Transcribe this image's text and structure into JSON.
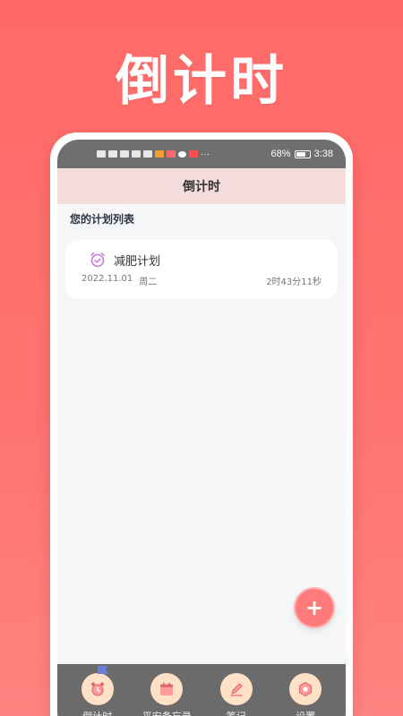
{
  "hero": {
    "title": "倒计时"
  },
  "statusbar": {
    "battery": "68%",
    "time": "3:38"
  },
  "appbar": {
    "title": "倒计时"
  },
  "list": {
    "section_title": "您的计划列表",
    "plans": [
      {
        "name": "减肥计划",
        "date": "2022.11.01",
        "weekday": "周二",
        "remaining": "2时43分11秒"
      }
    ]
  },
  "fab": {
    "label": "+"
  },
  "nav": {
    "items": [
      {
        "label": "倒计时",
        "icon": "alarm-clock-icon"
      },
      {
        "label": "平安备忘录",
        "icon": "calendar-icon"
      },
      {
        "label": "笔记",
        "icon": "pen-icon"
      },
      {
        "label": "设置",
        "icon": "gear-icon"
      }
    ]
  },
  "colors": {
    "accent": "#ff7b7b",
    "appbar_bg": "#f4dcdc",
    "nav_bg": "#6b6b6b",
    "nav_icon_bg": "#ffe1c8"
  }
}
